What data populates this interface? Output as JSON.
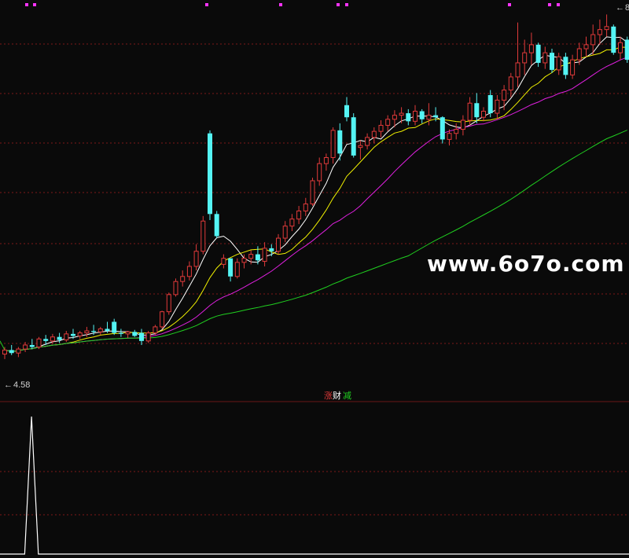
{
  "watermark": "www.6o7o.com",
  "price_label": "4.58",
  "peak_label": "8",
  "indicator_label": {
    "left": "涨",
    "mid": "财",
    "right": "减"
  },
  "colors": {
    "background": "#0a0a0a",
    "grid": "#b01e1e",
    "up": "#e03a3a",
    "down": "#54f4f4",
    "ma_white": "#ffffff",
    "ma_yellow": "#f0f000",
    "ma_magenta": "#e020e0",
    "ma_green": "#20d020",
    "dots": "#ff33ff",
    "indicator": "#ffffff"
  },
  "chart_data": [
    {
      "type": "candlestick",
      "title": "",
      "xlabel": "",
      "ylabel": "",
      "ylim": [
        4.4,
        8.05
      ],
      "grid": true,
      "marked_low": 4.58,
      "marked_high": 8.0,
      "candles": [
        [
          4.63,
          4.7,
          4.58,
          4.67
        ],
        [
          4.67,
          4.72,
          4.62,
          4.64
        ],
        [
          4.64,
          4.7,
          4.6,
          4.68
        ],
        [
          4.68,
          4.75,
          4.65,
          4.72
        ],
        [
          4.72,
          4.78,
          4.68,
          4.7
        ],
        [
          4.7,
          4.8,
          4.68,
          4.78
        ],
        [
          4.78,
          4.82,
          4.72,
          4.76
        ],
        [
          4.76,
          4.83,
          4.73,
          4.8
        ],
        [
          4.8,
          4.84,
          4.74,
          4.77
        ],
        [
          4.77,
          4.86,
          4.75,
          4.83
        ],
        [
          4.83,
          4.88,
          4.78,
          4.81
        ],
        [
          4.81,
          4.86,
          4.78,
          4.84
        ],
        [
          4.84,
          4.9,
          4.8,
          4.86
        ],
        [
          4.86,
          4.92,
          4.82,
          4.85
        ],
        [
          4.85,
          4.9,
          4.82,
          4.88
        ],
        [
          4.88,
          4.95,
          4.84,
          4.86
        ],
        [
          4.95,
          4.98,
          4.82,
          4.84
        ],
        [
          4.84,
          4.88,
          4.8,
          4.83
        ],
        [
          4.83,
          4.86,
          4.79,
          4.85
        ],
        [
          4.85,
          4.87,
          4.8,
          4.81
        ],
        [
          4.84,
          4.88,
          4.72,
          4.76
        ],
        [
          4.76,
          4.86,
          4.74,
          4.84
        ],
        [
          4.84,
          4.92,
          4.82,
          4.9
        ],
        [
          4.9,
          5.06,
          4.88,
          5.05
        ],
        [
          5.05,
          5.24,
          5.02,
          5.22
        ],
        [
          5.22,
          5.38,
          5.2,
          5.35
        ],
        [
          5.35,
          5.46,
          5.3,
          5.4
        ],
        [
          5.4,
          5.55,
          5.36,
          5.5
        ],
        [
          5.5,
          5.72,
          5.46,
          5.65
        ],
        [
          5.65,
          6.0,
          5.62,
          5.95
        ],
        [
          6.82,
          6.85,
          5.96,
          6.02
        ],
        [
          6.02,
          6.05,
          5.78,
          5.8
        ],
        [
          5.52,
          5.62,
          5.48,
          5.58
        ],
        [
          5.58,
          5.4,
          5.35,
          5.4
        ],
        [
          5.4,
          5.58,
          5.38,
          5.54
        ],
        [
          5.54,
          5.62,
          5.48,
          5.58
        ],
        [
          5.58,
          5.66,
          5.52,
          5.62
        ],
        [
          5.62,
          5.7,
          5.52,
          5.56
        ],
        [
          5.55,
          5.74,
          5.5,
          5.68
        ],
        [
          5.68,
          5.72,
          5.6,
          5.65
        ],
        [
          5.65,
          5.82,
          5.62,
          5.78
        ],
        [
          5.78,
          5.95,
          5.74,
          5.9
        ],
        [
          5.9,
          6.02,
          5.85,
          5.97
        ],
        [
          5.97,
          6.1,
          5.92,
          6.05
        ],
        [
          6.05,
          6.18,
          6.0,
          6.12
        ],
        [
          6.12,
          6.38,
          6.1,
          6.35
        ],
        [
          6.35,
          6.58,
          6.3,
          6.52
        ],
        [
          6.52,
          6.62,
          6.45,
          6.58
        ],
        [
          6.58,
          6.88,
          6.52,
          6.85
        ],
        [
          6.85,
          6.92,
          6.55,
          6.62
        ],
        [
          7.1,
          7.18,
          6.94,
          6.98
        ],
        [
          6.98,
          7.02,
          6.58,
          6.6
        ],
        [
          6.68,
          6.75,
          6.56,
          6.7
        ],
        [
          6.7,
          6.82,
          6.66,
          6.78
        ],
        [
          6.78,
          6.88,
          6.72,
          6.84
        ],
        [
          6.84,
          6.95,
          6.78,
          6.9
        ],
        [
          6.9,
          7.0,
          6.84,
          6.96
        ],
        [
          6.96,
          7.05,
          6.88,
          7.0
        ],
        [
          7.0,
          7.08,
          6.92,
          7.02
        ],
        [
          7.02,
          7.06,
          6.9,
          6.94
        ],
        [
          6.94,
          7.1,
          6.9,
          7.04
        ],
        [
          7.04,
          7.06,
          6.92,
          6.96
        ],
        [
          6.96,
          7.12,
          6.9,
          7.0
        ],
        [
          7.0,
          7.08,
          6.94,
          6.98
        ],
        [
          6.98,
          6.99,
          6.72,
          6.76
        ],
        [
          6.76,
          6.86,
          6.7,
          6.82
        ],
        [
          6.82,
          6.92,
          6.76,
          6.86
        ],
        [
          6.86,
          7.0,
          6.8,
          6.95
        ],
        [
          6.95,
          7.18,
          6.9,
          7.12
        ],
        [
          7.12,
          7.22,
          6.92,
          6.98
        ],
        [
          6.98,
          7.08,
          6.94,
          7.04
        ],
        [
          7.2,
          7.25,
          6.98,
          7.02
        ],
        [
          7.02,
          7.2,
          6.96,
          7.15
        ],
        [
          7.15,
          7.3,
          7.05,
          7.25
        ],
        [
          7.25,
          7.42,
          7.18,
          7.38
        ],
        [
          7.38,
          7.92,
          7.28,
          7.52
        ],
        [
          7.52,
          7.75,
          7.4,
          7.62
        ],
        [
          7.62,
          7.82,
          7.5,
          7.7
        ],
        [
          7.7,
          7.72,
          7.48,
          7.52
        ],
        [
          7.52,
          7.68,
          7.46,
          7.62
        ],
        [
          7.62,
          7.66,
          7.42,
          7.45
        ],
        [
          7.45,
          7.62,
          7.4,
          7.58
        ],
        [
          7.58,
          7.62,
          7.36,
          7.4
        ],
        [
          7.4,
          7.6,
          7.36,
          7.55
        ],
        [
          7.55,
          7.72,
          7.5,
          7.66
        ],
        [
          7.66,
          7.78,
          7.58,
          7.7
        ],
        [
          7.7,
          7.9,
          7.6,
          7.8
        ],
        [
          7.8,
          7.95,
          7.7,
          7.85
        ],
        [
          7.85,
          8.0,
          7.78,
          7.88
        ],
        [
          7.88,
          7.9,
          7.6,
          7.62
        ],
        [
          7.62,
          7.78,
          7.55,
          7.72
        ],
        [
          7.75,
          7.78,
          7.52,
          7.55
        ]
      ]
    },
    {
      "type": "line",
      "title": "",
      "xlabel": "",
      "ylabel": "",
      "ylim": [
        0,
        1
      ],
      "values": [
        0,
        0,
        0,
        1,
        0,
        0,
        0,
        0,
        0,
        0,
        0,
        0,
        0,
        0,
        0,
        0,
        0,
        0,
        0,
        0,
        0,
        0,
        0,
        0,
        0,
        0,
        0,
        0,
        0,
        0,
        0,
        0,
        0,
        0,
        0,
        0,
        0,
        0,
        0,
        0,
        0,
        0,
        0,
        0,
        0,
        0,
        0,
        0,
        0,
        0,
        0,
        0,
        0,
        0,
        0,
        0,
        0,
        0,
        0,
        0,
        0,
        0,
        0,
        0,
        0,
        0,
        0,
        0,
        0,
        0,
        0,
        0,
        0,
        0,
        0,
        0,
        0,
        0,
        0,
        0,
        0,
        0,
        0,
        0,
        0,
        0,
        0,
        0,
        0,
        0,
        0,
        0
      ]
    }
  ]
}
